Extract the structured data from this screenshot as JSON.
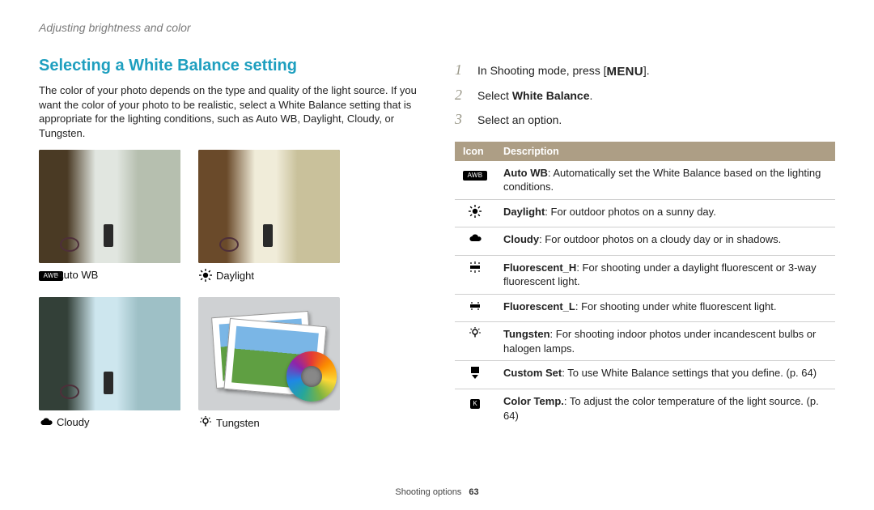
{
  "breadcrumb": "Adjusting brightness and color",
  "left": {
    "heading": "Selecting a White Balance setting",
    "intro": "The color of your photo depends on the type and quality of the light source. If you want the color of your photo to be realistic, select a White Balance setting that is appropriate for the lighting conditions, such as Auto WB, Daylight, Cloudy, or Tungsten.",
    "thumbs": [
      {
        "icon": "awb",
        "label": "Auto WB"
      },
      {
        "icon": "sun",
        "label": "Daylight"
      },
      {
        "icon": "cloud",
        "label": "Cloudy"
      },
      {
        "icon": "bulb",
        "label": "Tungsten"
      }
    ]
  },
  "steps": [
    {
      "num": "1",
      "pre": "In Shooting mode, press [",
      "badge": "MENU",
      "post": "]."
    },
    {
      "num": "2",
      "pre": "Select ",
      "bold": "White Balance",
      "post": "."
    },
    {
      "num": "3",
      "pre": "Select an option."
    }
  ],
  "table": {
    "head_icon": "Icon",
    "head_desc": "Description",
    "rows": [
      {
        "icon": "awb",
        "bold": "Auto WB",
        "rest": ": Automatically set the White Balance based on the lighting conditions."
      },
      {
        "icon": "sun",
        "bold": "Daylight",
        "rest": ": For outdoor photos on a sunny day."
      },
      {
        "icon": "cloud",
        "bold": "Cloudy",
        "rest": ": For outdoor photos on a cloudy day or in shadows."
      },
      {
        "icon": "fluoh",
        "bold": "Fluorescent_H",
        "rest": ": For shooting under a daylight fluorescent or 3-way fluorescent light."
      },
      {
        "icon": "fluol",
        "bold": "Fluorescent_L",
        "rest": ": For shooting under white fluorescent light."
      },
      {
        "icon": "bulb",
        "bold": "Tungsten",
        "rest": ": For shooting indoor photos under incandescent bulbs or halogen lamps."
      },
      {
        "icon": "custom",
        "bold": "Custom Set",
        "rest": ": To use White Balance settings that you define. (p. 64)"
      },
      {
        "icon": "k",
        "bold": "Color Temp.",
        "rest": ": To adjust the color temperature of the light source. (p. 64)"
      }
    ]
  },
  "footer": {
    "section": "Shooting options",
    "page": "63"
  }
}
